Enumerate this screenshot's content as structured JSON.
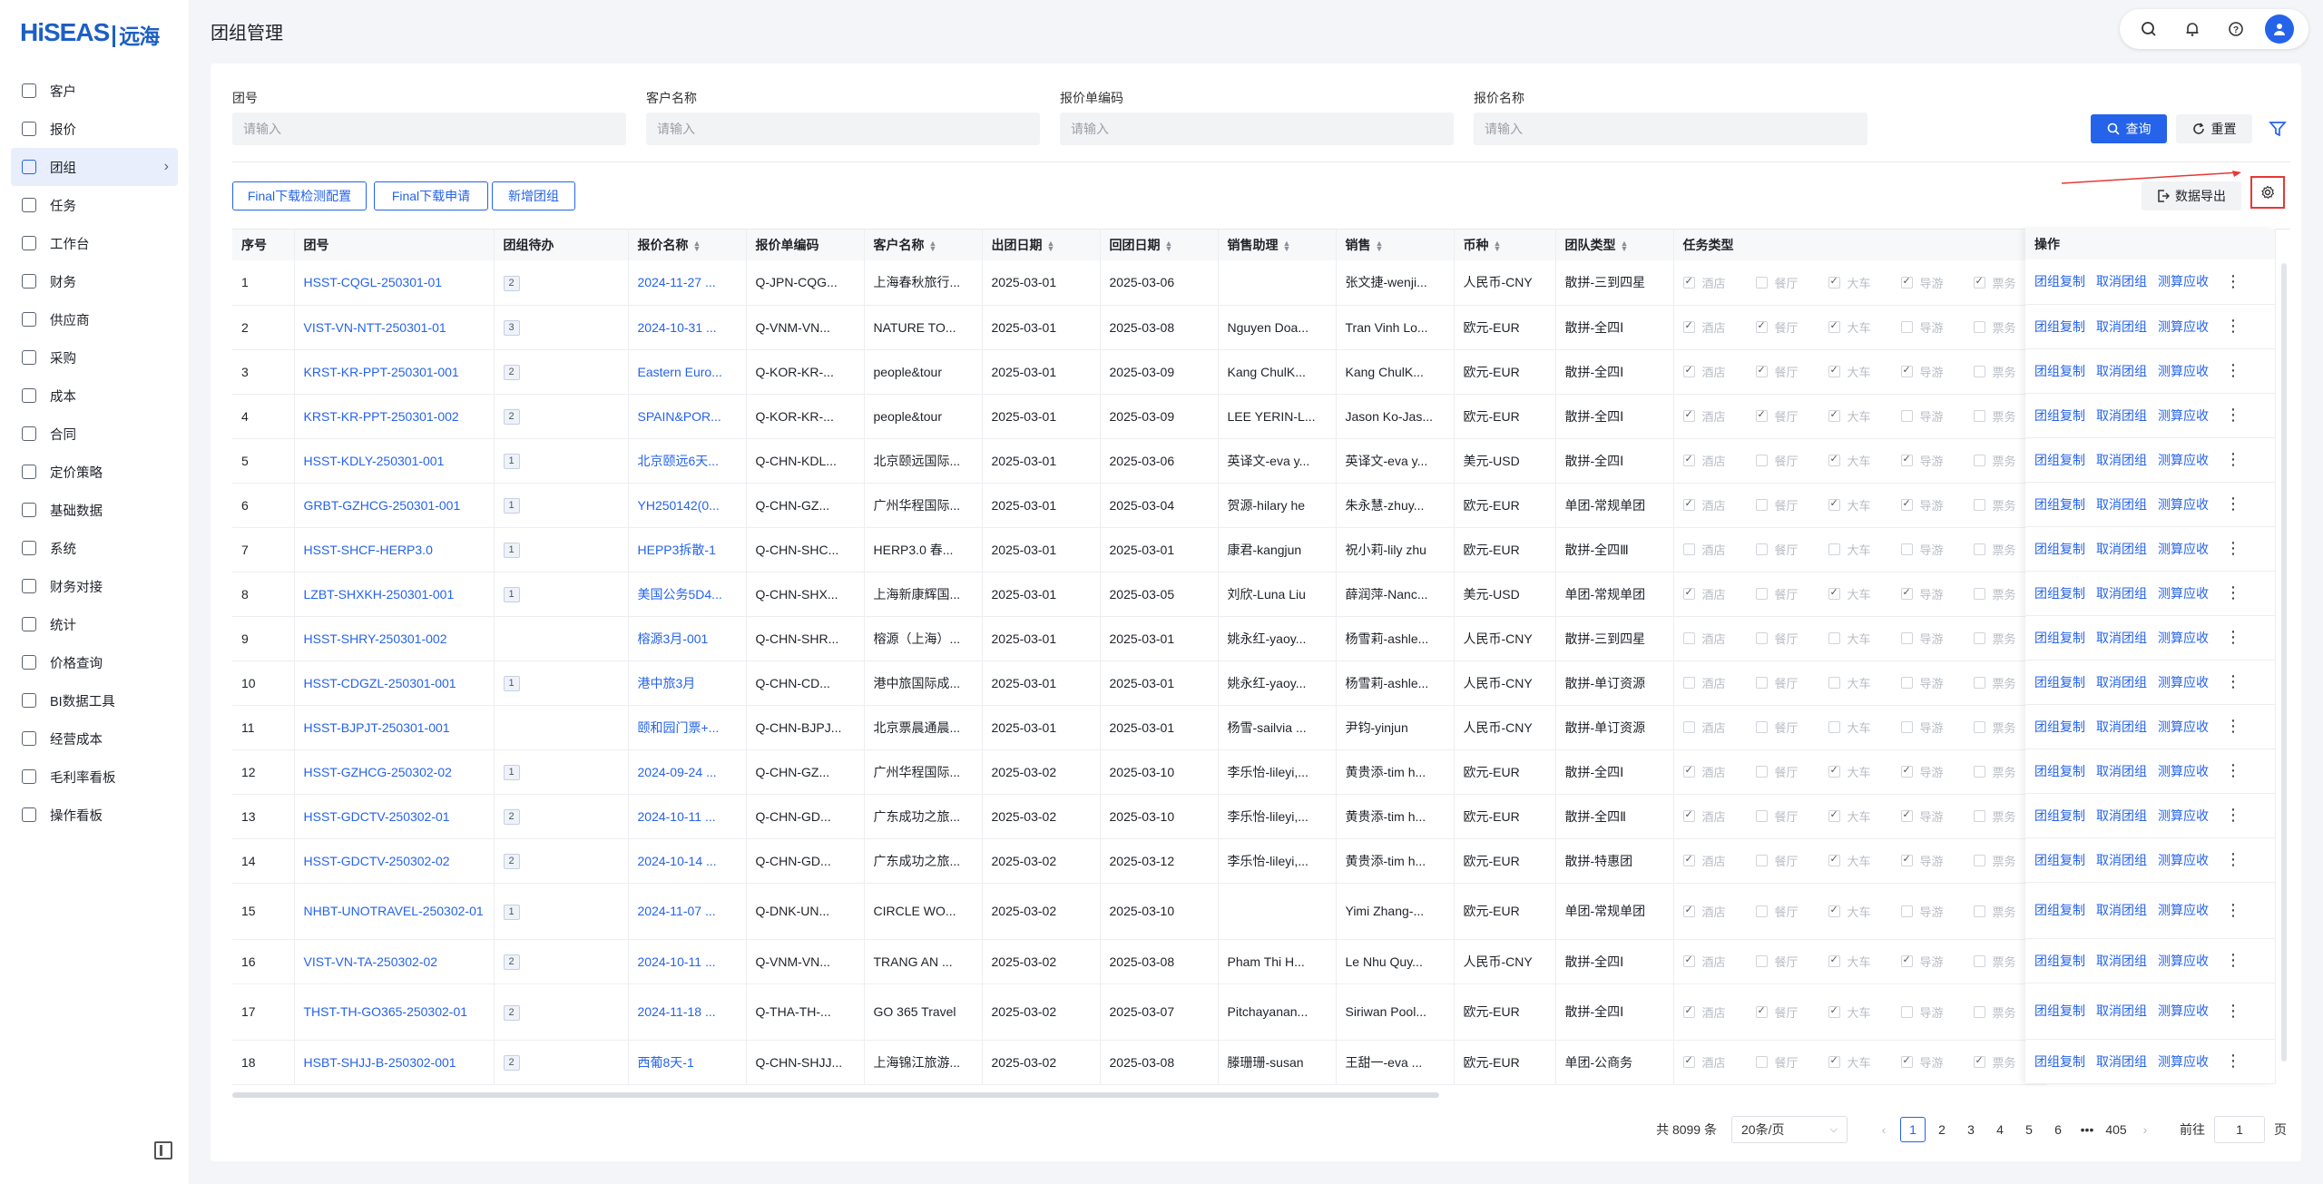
{
  "brand": {
    "logo_text": "HiSEAS",
    "logo_cn": "远海"
  },
  "sidebar": {
    "items": [
      {
        "label": "客户",
        "icon": "customer-icon"
      },
      {
        "label": "报价",
        "icon": "quote-icon"
      },
      {
        "label": "团组",
        "icon": "group-icon",
        "active": true
      },
      {
        "label": "任务",
        "icon": "task-icon"
      },
      {
        "label": "工作台",
        "icon": "workbench-icon"
      },
      {
        "label": "财务",
        "icon": "finance-icon"
      },
      {
        "label": "供应商",
        "icon": "supplier-icon"
      },
      {
        "label": "采购",
        "icon": "purchase-icon"
      },
      {
        "label": "成本",
        "icon": "cost-icon"
      },
      {
        "label": "合同",
        "icon": "contract-icon"
      },
      {
        "label": "定价策略",
        "icon": "pricing-icon"
      },
      {
        "label": "基础数据",
        "icon": "base-data-icon"
      },
      {
        "label": "系统",
        "icon": "system-icon"
      },
      {
        "label": "财务对接",
        "icon": "finance-link-icon"
      },
      {
        "label": "统计",
        "icon": "stats-icon"
      },
      {
        "label": "价格查询",
        "icon": "price-search-icon"
      },
      {
        "label": "BI数据工具",
        "icon": "bi-icon"
      },
      {
        "label": "经营成本",
        "icon": "operating-cost-icon"
      },
      {
        "label": "毛利率看板",
        "icon": "margin-board-icon"
      },
      {
        "label": "操作看板",
        "icon": "operation-board-icon"
      }
    ]
  },
  "header": {
    "title": "团组管理"
  },
  "filters": {
    "group_no": {
      "label": "团号",
      "placeholder": "请输入"
    },
    "customer": {
      "label": "客户名称",
      "placeholder": "请输入"
    },
    "quote_code": {
      "label": "报价单编码",
      "placeholder": "请输入"
    },
    "quote_name": {
      "label": "报价名称",
      "placeholder": "请输入"
    },
    "search_label": "查询",
    "reset_label": "重置"
  },
  "actions": {
    "final_config": "Final下载检测配置",
    "final_apply": "Final下载申请",
    "add_group": "新增团组",
    "export": "数据导出"
  },
  "table": {
    "columns": [
      "序号",
      "团号",
      "团组待办",
      "报价名称",
      "报价单编码",
      "客户名称",
      "出团日期",
      "回团日期",
      "销售助理",
      "销售",
      "币种",
      "团队类型",
      "任务类型",
      "操作"
    ],
    "task_types": [
      "酒店",
      "餐厅",
      "大车",
      "导游",
      "票务"
    ],
    "op_labels": [
      "团组复制",
      "取消团组",
      "测算应收"
    ],
    "rows": [
      {
        "no": "1",
        "group": "HSST-CQGL-250301-01",
        "todo": "2",
        "qname": "2024-11-27 ...",
        "qcode": "Q-JPN-CQG...",
        "cust": "上海春秋旅行...",
        "start": "2025-03-01",
        "end": "2025-03-06",
        "asst": "",
        "sales": "张文捷-wenji...",
        "cur": "人民币-CNY",
        "type": "散拼-三到四星",
        "tasks": [
          1,
          0,
          1,
          1,
          1
        ]
      },
      {
        "no": "2",
        "group": "VIST-VN-NTT-250301-01",
        "todo": "3",
        "qname": "2024-10-31 ...",
        "qcode": "Q-VNM-VN...",
        "cust": "NATURE TO...",
        "start": "2025-03-01",
        "end": "2025-03-08",
        "asst": "Nguyen Doa...",
        "sales": "Tran Vinh Lo...",
        "cur": "欧元-EUR",
        "type": "散拼-全四Ⅰ",
        "tasks": [
          1,
          1,
          1,
          0,
          0
        ]
      },
      {
        "no": "3",
        "group": "KRST-KR-PPT-250301-001",
        "todo": "2",
        "qname": "Eastern Euro...",
        "qcode": "Q-KOR-KR-...",
        "cust": "people&tour",
        "start": "2025-03-01",
        "end": "2025-03-09",
        "asst": "Kang ChulK...",
        "sales": "Kang ChulK...",
        "cur": "欧元-EUR",
        "type": "散拼-全四Ⅰ",
        "tasks": [
          1,
          1,
          1,
          1,
          0
        ]
      },
      {
        "no": "4",
        "group": "KRST-KR-PPT-250301-002",
        "todo": "2",
        "qname": "SPAIN&POR...",
        "qcode": "Q-KOR-KR-...",
        "cust": "people&tour",
        "start": "2025-03-01",
        "end": "2025-03-09",
        "asst": "LEE YERIN-L...",
        "sales": "Jason Ko-Jas...",
        "cur": "欧元-EUR",
        "type": "散拼-全四Ⅰ",
        "tasks": [
          1,
          1,
          1,
          0,
          0
        ]
      },
      {
        "no": "5",
        "group": "HSST-KDLY-250301-001",
        "todo": "1",
        "qname": "北京颐远6天...",
        "qcode": "Q-CHN-KDL...",
        "cust": "北京颐远国际...",
        "start": "2025-03-01",
        "end": "2025-03-06",
        "asst": "英译文-eva y...",
        "sales": "英译文-eva y...",
        "cur": "美元-USD",
        "type": "散拼-全四Ⅰ",
        "tasks": [
          1,
          0,
          1,
          1,
          0
        ]
      },
      {
        "no": "6",
        "group": "GRBT-GZHCG-250301-001",
        "todo": "1",
        "qname": "YH250142(0...",
        "qcode": "Q-CHN-GZ...",
        "cust": "广州华程国际...",
        "start": "2025-03-01",
        "end": "2025-03-04",
        "asst": "贺源-hilary he",
        "sales": "朱永慧-zhuy...",
        "cur": "欧元-EUR",
        "type": "单团-常规单团",
        "tasks": [
          1,
          0,
          1,
          1,
          0
        ]
      },
      {
        "no": "7",
        "group": "HSST-SHCF-HERP3.0",
        "todo": "1",
        "qname": "HEPP3拆散-1",
        "qcode": "Q-CHN-SHC...",
        "cust": "HERP3.0 春...",
        "start": "2025-03-01",
        "end": "2025-03-01",
        "asst": "康君-kangjun",
        "sales": "祝小莉-lily zhu",
        "cur": "欧元-EUR",
        "type": "散拼-全四Ⅲ",
        "tasks": [
          0,
          0,
          0,
          0,
          0
        ]
      },
      {
        "no": "8",
        "group": "LZBT-SHXKH-250301-001",
        "todo": "1",
        "qname": "美国公务5D4...",
        "qcode": "Q-CHN-SHX...",
        "cust": "上海新康辉国...",
        "start": "2025-03-01",
        "end": "2025-03-05",
        "asst": "刘欣-Luna Liu",
        "sales": "薛润萍-Nanc...",
        "cur": "美元-USD",
        "type": "单团-常规单团",
        "tasks": [
          1,
          0,
          1,
          1,
          0
        ]
      },
      {
        "no": "9",
        "group": "HSST-SHRY-250301-002",
        "todo": "",
        "qname": "榕源3月-001",
        "qcode": "Q-CHN-SHR...",
        "cust": "榕源（上海）...",
        "start": "2025-03-01",
        "end": "2025-03-01",
        "asst": "姚永红-yaoy...",
        "sales": "杨雪莉-ashle...",
        "cur": "人民币-CNY",
        "type": "散拼-三到四星",
        "tasks": [
          0,
          0,
          0,
          0,
          0
        ]
      },
      {
        "no": "10",
        "group": "HSST-CDGZL-250301-001",
        "todo": "1",
        "qname": "港中旅3月",
        "qcode": "Q-CHN-CD...",
        "cust": "港中旅国际成...",
        "start": "2025-03-01",
        "end": "2025-03-01",
        "asst": "姚永红-yaoy...",
        "sales": "杨雪莉-ashle...",
        "cur": "人民币-CNY",
        "type": "散拼-单订资源",
        "tasks": [
          0,
          0,
          0,
          0,
          0
        ]
      },
      {
        "no": "11",
        "group": "HSST-BJPJT-250301-001",
        "todo": "",
        "qname": "颐和园门票+...",
        "qcode": "Q-CHN-BJPJ...",
        "cust": "北京票晨通晨...",
        "start": "2025-03-01",
        "end": "2025-03-01",
        "asst": "杨雪-sailvia ...",
        "sales": "尹钧-yinjun",
        "cur": "人民币-CNY",
        "type": "散拼-单订资源",
        "tasks": [
          0,
          0,
          0,
          0,
          0
        ]
      },
      {
        "no": "12",
        "group": "HSST-GZHCG-250302-02",
        "todo": "1",
        "qname": "2024-09-24 ...",
        "qcode": "Q-CHN-GZ...",
        "cust": "广州华程国际...",
        "start": "2025-03-02",
        "end": "2025-03-10",
        "asst": "李乐怡-lileyi,...",
        "sales": "黄贵添-tim h...",
        "cur": "欧元-EUR",
        "type": "散拼-全四Ⅰ",
        "tasks": [
          1,
          0,
          1,
          1,
          0
        ]
      },
      {
        "no": "13",
        "group": "HSST-GDCTV-250302-01",
        "todo": "2",
        "qname": "2024-10-11 ...",
        "qcode": "Q-CHN-GD...",
        "cust": "广东成功之旅...",
        "start": "2025-03-02",
        "end": "2025-03-10",
        "asst": "李乐怡-lileyi,...",
        "sales": "黄贵添-tim h...",
        "cur": "欧元-EUR",
        "type": "散拼-全四Ⅱ",
        "tasks": [
          1,
          0,
          1,
          1,
          0
        ]
      },
      {
        "no": "14",
        "group": "HSST-GDCTV-250302-02",
        "todo": "2",
        "qname": "2024-10-14 ...",
        "qcode": "Q-CHN-GD...",
        "cust": "广东成功之旅...",
        "start": "2025-03-02",
        "end": "2025-03-12",
        "asst": "李乐怡-lileyi,...",
        "sales": "黄贵添-tim h...",
        "cur": "欧元-EUR",
        "type": "散拼-特惠团",
        "tasks": [
          1,
          0,
          1,
          1,
          0
        ]
      },
      {
        "no": "15",
        "group": "NHBT-UNOTRAVEL-250302-01",
        "todo": "1",
        "qname": "2024-11-07 ...",
        "qcode": "Q-DNK-UN...",
        "cust": "CIRCLE WO...",
        "start": "2025-03-02",
        "end": "2025-03-10",
        "asst": "",
        "sales": "Yimi Zhang-...",
        "cur": "欧元-EUR",
        "type": "单团-常规单团",
        "tasks": [
          1,
          0,
          1,
          0,
          0
        ],
        "tall": true
      },
      {
        "no": "16",
        "group": "VIST-VN-TA-250302-02",
        "todo": "2",
        "qname": "2024-10-11 ...",
        "qcode": "Q-VNM-VN...",
        "cust": "TRANG AN ...",
        "start": "2025-03-02",
        "end": "2025-03-08",
        "asst": "Pham Thi H...",
        "sales": "Le Nhu Quy...",
        "cur": "人民币-CNY",
        "type": "散拼-全四Ⅰ",
        "tasks": [
          1,
          0,
          1,
          1,
          0
        ]
      },
      {
        "no": "17",
        "group": "THST-TH-GO365-250302-01",
        "todo": "2",
        "qname": "2024-11-18 ...",
        "qcode": "Q-THA-TH-...",
        "cust": "GO 365 Travel",
        "start": "2025-03-02",
        "end": "2025-03-07",
        "asst": "Pitchayanan...",
        "sales": "Siriwan Pool...",
        "cur": "欧元-EUR",
        "type": "散拼-全四Ⅰ",
        "tasks": [
          1,
          1,
          1,
          0,
          0
        ],
        "tall": true
      },
      {
        "no": "18",
        "group": "HSBT-SHJJ-B-250302-001",
        "todo": "2",
        "qname": "西葡8天-1",
        "qcode": "Q-CHN-SHJJ...",
        "cust": "上海锦江旅游...",
        "start": "2025-03-02",
        "end": "2025-03-08",
        "asst": "滕珊珊-susan",
        "sales": "王甜一-eva ...",
        "cur": "欧元-EUR",
        "type": "单团-公商务",
        "tasks": [
          1,
          0,
          1,
          1,
          1
        ]
      }
    ]
  },
  "pagination": {
    "total": "共 8099 条",
    "page_size": "20条/页",
    "pages": [
      "1",
      "2",
      "3",
      "4",
      "5",
      "6",
      "•••",
      "405"
    ],
    "current": "1",
    "goto_label": "前往",
    "goto_value": "1",
    "page_suffix": "页"
  },
  "colors": {
    "primary": "#2563eb",
    "annotation": "#e53935"
  }
}
